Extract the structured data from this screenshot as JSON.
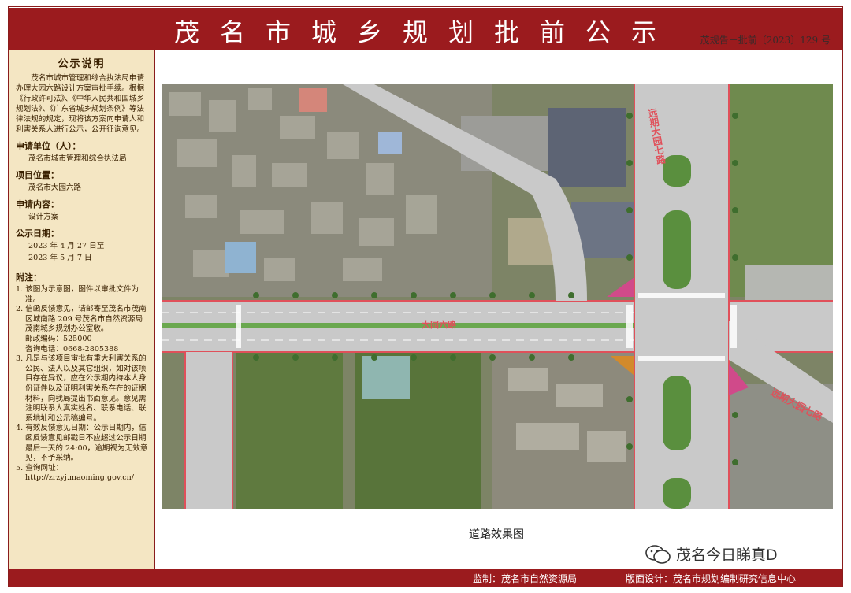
{
  "header": {
    "title": "茂名市城乡规划批前公示",
    "doc_no": "茂规告－批前〔2023〕129 号"
  },
  "sidebar": {
    "heading": "公示说明",
    "intro": "茂名市城市管理和综合执法局申请办理大园六路设计方案审批手续。根据《行政许可法》、《中华人民共和国城乡规划法》、《广东省城乡规划条例》等法律法规的规定，现将该方案向申请人和利害关系人进行公示，公开征询意见。",
    "applicant_label": "申请单位（人）：",
    "applicant": "茂名市城市管理和综合执法局",
    "location_label": "项目位置：",
    "location": "茂名市大园六路",
    "content_label": "申请内容：",
    "content": "设计方案",
    "date_label": "公示日期：",
    "date_from": "2023 年 4 月 27 日至",
    "date_to": "2023 年 5 月 7 日",
    "notes_label": "附注：",
    "notes": [
      "1. 该图为示意图，图件以审批文件为准。",
      "2. 信函反馈意见，请邮寄至茂名市茂南区城南路 209 号茂名市自然资源局茂南城乡规划办公室收。",
      "3. 凡是与该项目审批有重大利害关系的公民、法人以及其它组织，如对该项目存在异议，应在公示期内持本人身份证件以及证明利害关系存在的证据材料，向我局提出书面意见。意见需注明联系人真实姓名、联系电话、联系地址和公示稿编号。",
      "4. 有效反馈意见日期：公示日期内，信函反馈意见邮戳日不应超过公示日期最后一天的 24:00，逾期视为无效意见，不予采纳。",
      "5. 查询网址："
    ],
    "postcode": "邮政编码：525000",
    "phone": "咨询电话：0668-2805388",
    "url": "http://zrzyj.maoming.gov.cn/"
  },
  "map": {
    "road_labels": [
      "远期大园七路",
      "大园六路",
      "远期大园七路"
    ]
  },
  "caption": "道路效果图",
  "footer": {
    "supervisor": "监制：茂名市自然资源局",
    "designer": "版面设计：茂名市规划编制研究信息中心"
  },
  "watermark": "茂名今日睇真D",
  "colors": {
    "brand": "#9b1b1e",
    "panel": "#f4e6c3",
    "road_red": "#e0505a"
  }
}
